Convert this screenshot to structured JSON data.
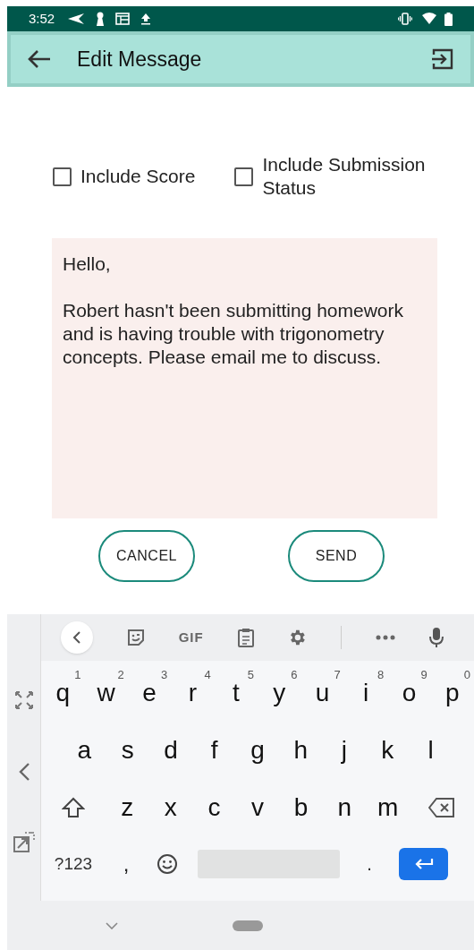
{
  "status_bar": {
    "time": "3:52"
  },
  "app_bar": {
    "title": "Edit Message"
  },
  "options": [
    {
      "label": "Include Score",
      "checked": false
    },
    {
      "label": "Include Submission Status",
      "checked": false
    }
  ],
  "message": {
    "value": "Hello,\n\nRobert hasn't been submitting homework and is having trouble with trigonometry concepts. Please email me to discuss."
  },
  "buttons": [
    "CANCEL",
    "SEND"
  ],
  "keyboard": {
    "gif": "GIF",
    "rows": [
      [
        {
          "label": "q",
          "hint": "1"
        },
        {
          "label": "w",
          "hint": "2"
        },
        {
          "label": "e",
          "hint": "3"
        },
        {
          "label": "r",
          "hint": "4"
        },
        {
          "label": "t",
          "hint": "5"
        },
        {
          "label": "y",
          "hint": "6"
        },
        {
          "label": "u",
          "hint": "7"
        },
        {
          "label": "i",
          "hint": "8"
        },
        {
          "label": "o",
          "hint": "9"
        },
        {
          "label": "p",
          "hint": "0"
        }
      ],
      [
        {
          "label": "a"
        },
        {
          "label": "s"
        },
        {
          "label": "d"
        },
        {
          "label": "f"
        },
        {
          "label": "g"
        },
        {
          "label": "h"
        },
        {
          "label": "j"
        },
        {
          "label": "k"
        },
        {
          "label": "l"
        }
      ],
      [
        {
          "label": "z"
        },
        {
          "label": "x"
        },
        {
          "label": "c"
        },
        {
          "label": "v"
        },
        {
          "label": "b"
        },
        {
          "label": "n"
        },
        {
          "label": "m"
        }
      ]
    ],
    "symbols": "?123",
    "comma": ",",
    "period": "."
  }
}
